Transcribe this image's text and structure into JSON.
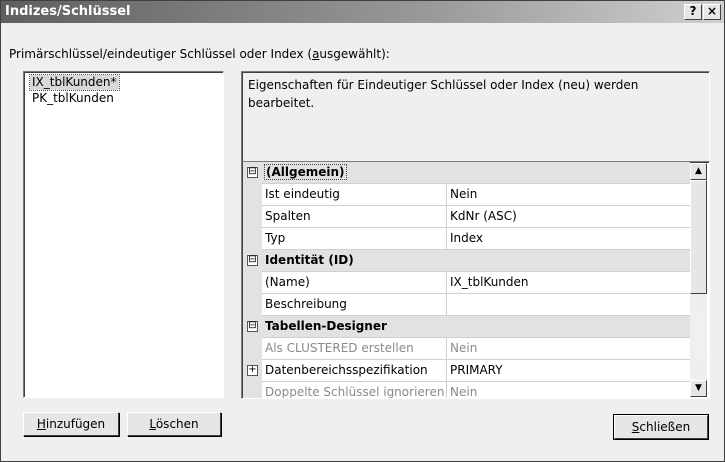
{
  "window": {
    "title": "Indizes/Schlüssel",
    "help_label": "?",
    "close_label": "×"
  },
  "prompt": {
    "pre": "Primärschlüssel/eindeutiger Schlüssel oder Index (",
    "accel": "a",
    "post": "usgewählt):"
  },
  "index_list": [
    "IX_tblKunden*",
    "PK_tblKunden"
  ],
  "description": "Eigenschaften für Eindeutiger Schlüssel oder Index (neu) werden bearbeitet.",
  "properties": {
    "categories": [
      {
        "name": "(Allgemein)",
        "expander": "⊟",
        "rows": [
          {
            "name": "Ist eindeutig",
            "value": "Nein"
          },
          {
            "name": "Spalten",
            "value": "KdNr (ASC)"
          },
          {
            "name": "Typ",
            "value": "Index"
          }
        ]
      },
      {
        "name": "Identität (ID)",
        "expander": "⊟",
        "rows": [
          {
            "name": "(Name)",
            "value": "IX_tblKunden"
          },
          {
            "name": "Beschreibung",
            "value": ""
          }
        ]
      },
      {
        "name": "Tabellen-Designer",
        "expander": "⊟",
        "rows": [
          {
            "name": "Als CLUSTERED erstellen",
            "value": "Nein"
          },
          {
            "name": "Datenbereichsspezifikation",
            "value": "PRIMARY"
          },
          {
            "name": "Doppelte Schlüssel ignorieren",
            "value": "Nein"
          }
        ]
      }
    ]
  },
  "buttons": {
    "add_accel": "H",
    "add_rest": "inzufügen",
    "delete_accel": "L",
    "delete_rest": "öschen",
    "close_accel": "S",
    "close_rest": "chließen"
  },
  "scroll": {
    "up": "▲",
    "down": "▼"
  }
}
